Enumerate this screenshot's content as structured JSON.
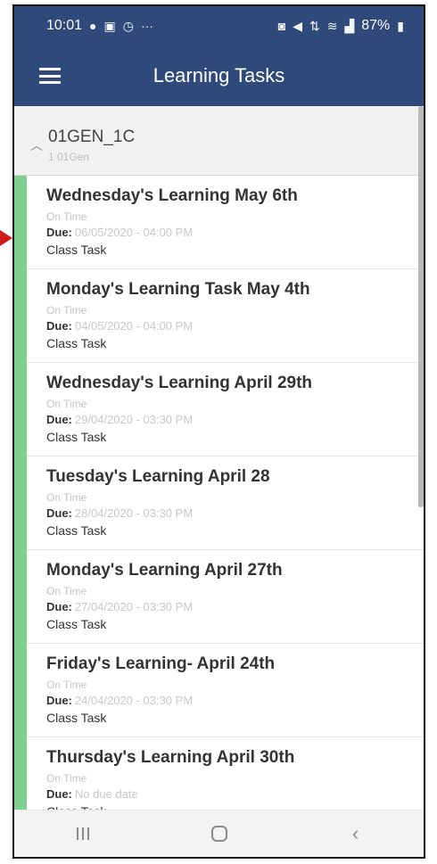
{
  "status_bar": {
    "time": "10:01",
    "left_icons": [
      "facebook-icon",
      "gallery-icon",
      "alarm-icon",
      "more-icon"
    ],
    "battery": "87%",
    "right_icons": [
      "alarm-icon",
      "mute-icon",
      "lte-icon",
      "wifi-icon",
      "signal-icon",
      "battery-icon"
    ]
  },
  "app_bar": {
    "title": "Learning Tasks",
    "menu_icon": "menu-icon"
  },
  "group": {
    "name": "01GEN_1C",
    "subtitle": "1 01Gen"
  },
  "tasks": [
    {
      "title": "Wednesday's Learning May 6th",
      "status": "On Time",
      "due_label": "Due:",
      "due_date": "06/05/2020 - 04:00 PM",
      "type": "Class Task"
    },
    {
      "title": "Monday's Learning Task May 4th",
      "status": "On Time",
      "due_label": "Due:",
      "due_date": "04/05/2020 - 04:00 PM",
      "type": "Class Task"
    },
    {
      "title": "Wednesday's Learning April 29th",
      "status": "On Time",
      "due_label": "Due:",
      "due_date": "29/04/2020 - 03:30 PM",
      "type": "Class Task"
    },
    {
      "title": "Tuesday's Learning April 28",
      "status": "On Time",
      "due_label": "Due:",
      "due_date": "28/04/2020 - 03:30 PM",
      "type": "Class Task"
    },
    {
      "title": "Monday's Learning April 27th",
      "status": "On Time",
      "due_label": "Due:",
      "due_date": "27/04/2020 - 03:30 PM",
      "type": "Class Task"
    },
    {
      "title": "Friday's Learning- April 24th",
      "status": "On Time",
      "due_label": "Due:",
      "due_date": "24/04/2020 - 03:30 PM",
      "type": "Class Task"
    },
    {
      "title": "Thursday's Learning April 30th",
      "status": "On Time",
      "due_label": "Due:",
      "due_date": "No due date",
      "type": "Class Task"
    }
  ],
  "nav_bar": {
    "recent_icon": "recent-apps-icon",
    "home_icon": "home-icon",
    "back_icon": "back-icon"
  },
  "colors": {
    "header": "#2f4a7a",
    "accent": "#7fcf8f",
    "pointer": "#d11a1a"
  }
}
